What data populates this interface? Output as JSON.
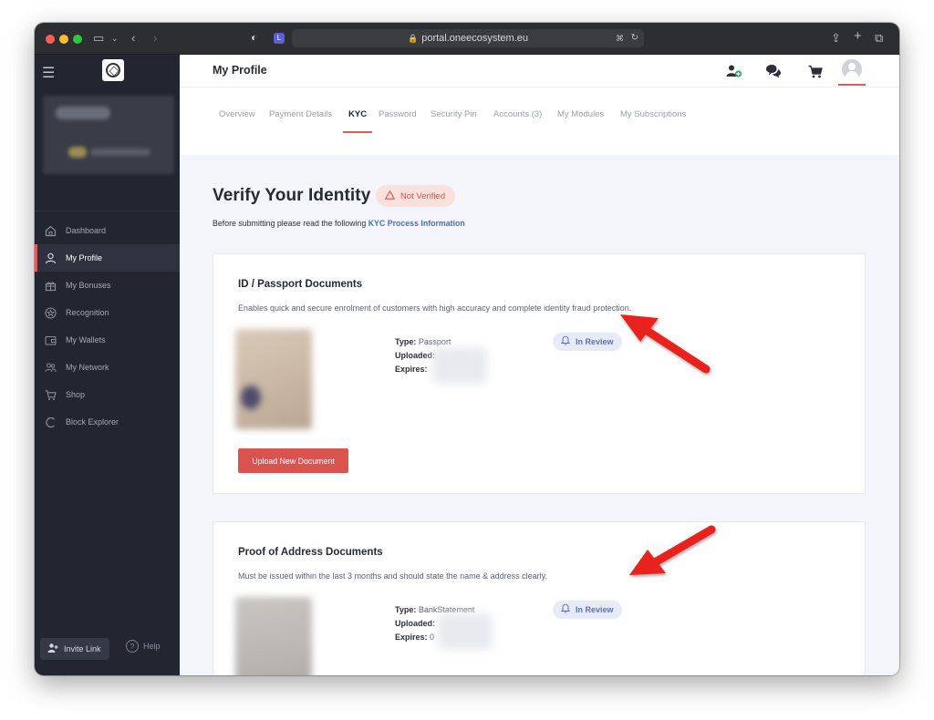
{
  "browser": {
    "url": "portal.oneecosystem.eu"
  },
  "sidebar": {
    "items": [
      {
        "label": "Dashboard",
        "icon": "home-icon"
      },
      {
        "label": "My Profile",
        "icon": "user-icon",
        "active": true
      },
      {
        "label": "My Bonuses",
        "icon": "gift-icon"
      },
      {
        "label": "Recognition",
        "icon": "star-icon"
      },
      {
        "label": "My Wallets",
        "icon": "wallet-icon"
      },
      {
        "label": "My Network",
        "icon": "network-icon"
      },
      {
        "label": "Shop",
        "icon": "cart-icon"
      },
      {
        "label": "Block Explorer",
        "icon": "explorer-icon"
      }
    ],
    "invite_label": "Invite Link",
    "help_label": "Help"
  },
  "header": {
    "title": "My Profile"
  },
  "tabs": [
    {
      "label": "Overview"
    },
    {
      "label": "Payment Details"
    },
    {
      "label": "KYC",
      "active": true
    },
    {
      "label": "Password"
    },
    {
      "label": "Security Pin"
    },
    {
      "label": "Accounts (3)"
    },
    {
      "label": "My Modules"
    },
    {
      "label": "My Subscriptions"
    }
  ],
  "kyc": {
    "title": "Verify Your Identity",
    "status": "Not Verified",
    "intro_prefix": "Before submitting please read the following",
    "intro_link": "KYC Process Information"
  },
  "documents": [
    {
      "title": "ID / Passport Documents",
      "description": "Enables quick and secure enrolment of customers with high accuracy and complete identity fraud protection.",
      "type_label": "Type:",
      "type_value": "Passport",
      "uploaded_label": "Uploaded:",
      "expires_label": "Expires:",
      "status": "In Review",
      "upload_button": "Upload New Document"
    },
    {
      "title": "Proof of Address Documents",
      "description": "Must be issued within the last 3 months and should state the name & address clearly.",
      "type_label": "Type:",
      "type_value": "BankStatement",
      "uploaded_label": "Uploaded:",
      "expires_label": "Expires:",
      "expires_partial": "0",
      "status": "In Review"
    }
  ],
  "colors": {
    "accent": "#e05a56",
    "sidebar_bg": "#232530",
    "review_badge": "#5b72b8"
  }
}
